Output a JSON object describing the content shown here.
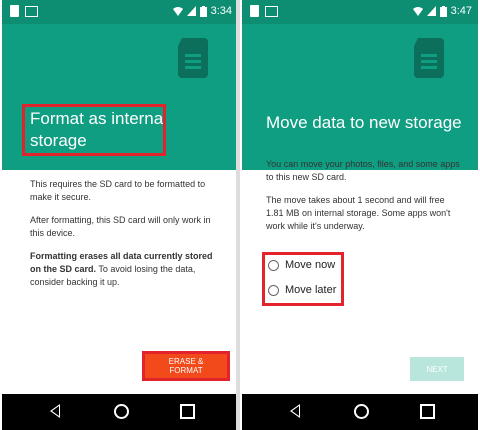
{
  "status_bar": {
    "left_time": "3:34",
    "right_time": "3:47"
  },
  "left_screen": {
    "title": "Format as internal storage",
    "body": {
      "p1": "This requires the SD card to be formatted to make it secure.",
      "p2": "After formatting, this SD card will only work in this device.",
      "p3_bold": "Formatting erases all data currently stored on the SD card.",
      "p3_rest": " To avoid losing the data, consider backing it up."
    },
    "action_button": "ERASE & FORMAT"
  },
  "right_screen": {
    "title": "Move data to new storage",
    "body": {
      "p1": "You can move your photos, files, and some apps to this new SD card.",
      "p2": "The move takes about 1 second and will free 1.81 MB on internal storage. Some apps won't work while it's underway."
    },
    "options": [
      {
        "label": "Move now"
      },
      {
        "label": "Move later"
      }
    ],
    "action_button": "NEXT"
  },
  "colors": {
    "header": "#0f9e82",
    "status_bar": "#0d8e73",
    "accent_button": "#f24a1a",
    "next_disabled": "#b8e5dc",
    "highlight_red": "#e3232b"
  },
  "icons": [
    "sd-card-icon",
    "wifi-icon",
    "battery-icon",
    "back-icon",
    "home-icon",
    "recents-icon"
  ]
}
